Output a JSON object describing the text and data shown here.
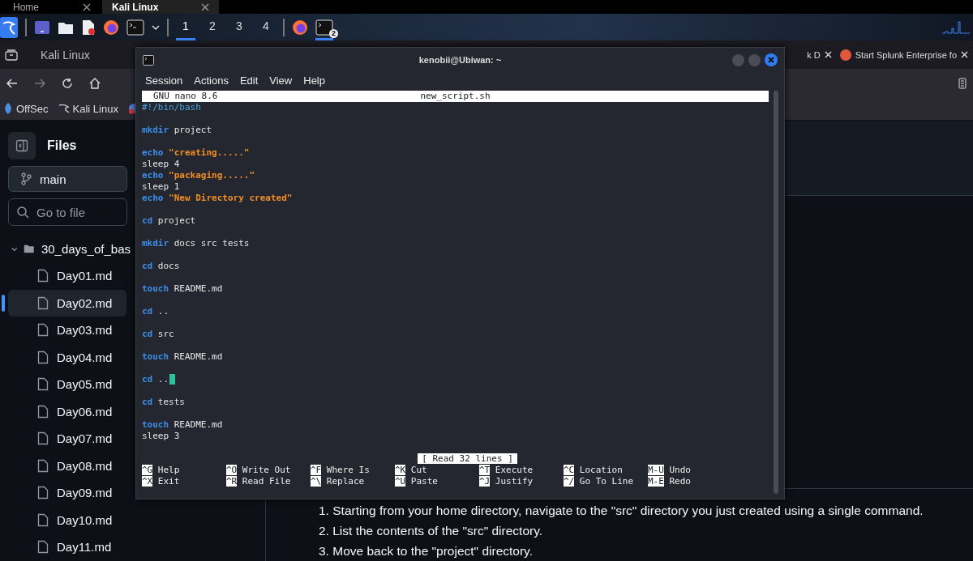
{
  "top_tabs": [
    {
      "label": "Home",
      "selected": false
    },
    {
      "label": "Kali Linux",
      "selected": true
    }
  ],
  "taskbar": {
    "workspaces": [
      {
        "label": "1",
        "selected": true
      },
      {
        "label": "2",
        "selected": false
      },
      {
        "label": "3",
        "selected": false
      },
      {
        "label": "4",
        "selected": false
      }
    ],
    "terminal_badge": "2"
  },
  "browser": {
    "tabs": [
      {
        "label": "Kali Linux"
      },
      {
        "label": "k D"
      },
      {
        "label": "Start Splunk Enterprise fo"
      }
    ],
    "bookmarks": [
      {
        "label": "OffSec"
      },
      {
        "label": "Kali Linux"
      }
    ]
  },
  "sidebar": {
    "title": "Files",
    "branch": "main",
    "search": {
      "placeholder": "Go to file"
    },
    "folder": {
      "name": "30_days_of_bas",
      "expanded": true,
      "children": [
        {
          "name": "Day01.md",
          "selected": false
        },
        {
          "name": "Day02.md",
          "selected": true
        },
        {
          "name": "Day03.md",
          "selected": false
        },
        {
          "name": "Day04.md",
          "selected": false
        },
        {
          "name": "Day05.md",
          "selected": false
        },
        {
          "name": "Day06.md",
          "selected": false
        },
        {
          "name": "Day07.md",
          "selected": false
        },
        {
          "name": "Day08.md",
          "selected": false
        },
        {
          "name": "Day09.md",
          "selected": false
        },
        {
          "name": "Day10.md",
          "selected": false
        },
        {
          "name": "Day11.md",
          "selected": false
        }
      ]
    }
  },
  "content": {
    "list": [
      "1. Starting from your home directory, navigate to the \"src\" directory you just created using a single command.",
      "2. List the contents of the \"src\" directory.",
      "3. Move back to the \"project\" directory."
    ]
  },
  "terminal": {
    "title": "kenobii@Ubiwan: ~",
    "menu": [
      "Session",
      "Actions",
      "Edit",
      "View",
      "Help"
    ],
    "nano": {
      "version": "GNU nano 8.6",
      "file": "new_script.sh",
      "status": "[ Read 32 lines ]",
      "lines": [
        {
          "kind": "code",
          "cursor": false,
          "tokens": [
            {
              "kind": "shebang",
              "text": "#!/bin/bash"
            }
          ]
        },
        {
          "kind": "blank"
        },
        {
          "kind": "code",
          "cursor": false,
          "tokens": [
            {
              "kind": "command",
              "text": "mkdir"
            },
            {
              "kind": "text",
              "text": "project"
            }
          ]
        },
        {
          "kind": "blank"
        },
        {
          "kind": "code",
          "cursor": false,
          "tokens": [
            {
              "kind": "command",
              "text": "echo"
            },
            {
              "kind": "string",
              "text": "\"creating.....\""
            }
          ]
        },
        {
          "kind": "code",
          "cursor": false,
          "tokens": [
            {
              "kind": "text",
              "text": "sleep 4"
            }
          ]
        },
        {
          "kind": "code",
          "cursor": false,
          "tokens": [
            {
              "kind": "command",
              "text": "echo"
            },
            {
              "kind": "string",
              "text": "\"packaging.....\""
            }
          ]
        },
        {
          "kind": "code",
          "cursor": false,
          "tokens": [
            {
              "kind": "text",
              "text": "sleep 1"
            }
          ]
        },
        {
          "kind": "code",
          "cursor": false,
          "tokens": [
            {
              "kind": "command",
              "text": "echo"
            },
            {
              "kind": "string",
              "text": "\"New Directory created\""
            }
          ]
        },
        {
          "kind": "blank"
        },
        {
          "kind": "code",
          "cursor": false,
          "tokens": [
            {
              "kind": "command",
              "text": "cd"
            },
            {
              "kind": "text",
              "text": "project"
            }
          ]
        },
        {
          "kind": "blank"
        },
        {
          "kind": "code",
          "cursor": false,
          "tokens": [
            {
              "kind": "command",
              "text": "mkdir"
            },
            {
              "kind": "text",
              "text": "docs src tests"
            }
          ]
        },
        {
          "kind": "blank"
        },
        {
          "kind": "code",
          "cursor": false,
          "tokens": [
            {
              "kind": "command",
              "text": "cd"
            },
            {
              "kind": "text",
              "text": "docs"
            }
          ]
        },
        {
          "kind": "blank"
        },
        {
          "kind": "code",
          "cursor": false,
          "tokens": [
            {
              "kind": "command",
              "text": "touch"
            },
            {
              "kind": "text",
              "text": "README.md"
            }
          ]
        },
        {
          "kind": "blank"
        },
        {
          "kind": "code",
          "cursor": false,
          "tokens": [
            {
              "kind": "command",
              "text": "cd"
            },
            {
              "kind": "text",
              "text": ".."
            }
          ]
        },
        {
          "kind": "blank"
        },
        {
          "kind": "code",
          "cursor": false,
          "tokens": [
            {
              "kind": "command",
              "text": "cd"
            },
            {
              "kind": "text",
              "text": "src"
            }
          ]
        },
        {
          "kind": "blank"
        },
        {
          "kind": "code",
          "cursor": false,
          "tokens": [
            {
              "kind": "command",
              "text": "touch"
            },
            {
              "kind": "text",
              "text": "README.md"
            }
          ]
        },
        {
          "kind": "blank"
        },
        {
          "kind": "code",
          "cursor": true,
          "tokens": [
            {
              "kind": "command",
              "text": "cd"
            },
            {
              "kind": "text",
              "text": ".."
            }
          ]
        },
        {
          "kind": "blank"
        },
        {
          "kind": "code",
          "cursor": false,
          "tokens": [
            {
              "kind": "command",
              "text": "cd"
            },
            {
              "kind": "text",
              "text": "tests"
            }
          ]
        },
        {
          "kind": "blank"
        },
        {
          "kind": "code",
          "cursor": false,
          "tokens": [
            {
              "kind": "command",
              "text": "touch"
            },
            {
              "kind": "text",
              "text": "README.md"
            }
          ]
        },
        {
          "kind": "code",
          "cursor": false,
          "tokens": [
            {
              "kind": "text",
              "text": "sleep 3"
            }
          ]
        }
      ],
      "shortcuts": [
        {
          "key": "^G",
          "label": "Help"
        },
        {
          "key": "^X",
          "label": "Exit"
        },
        {
          "key": "^O",
          "label": "Write Out"
        },
        {
          "key": "^R",
          "label": "Read File"
        },
        {
          "key": "^F",
          "label": "Where Is"
        },
        {
          "key": "^\\",
          "label": "Replace"
        },
        {
          "key": "^K",
          "label": "Cut"
        },
        {
          "key": "^U",
          "label": "Paste"
        },
        {
          "key": "^T",
          "label": "Execute"
        },
        {
          "key": "^J",
          "label": "Justify"
        },
        {
          "key": "^C",
          "label": "Location"
        },
        {
          "key": "^/",
          "label": "Go To Line"
        },
        {
          "key": "M-U",
          "label": "Undo"
        },
        {
          "key": "M-E",
          "label": "Redo"
        }
      ]
    }
  }
}
